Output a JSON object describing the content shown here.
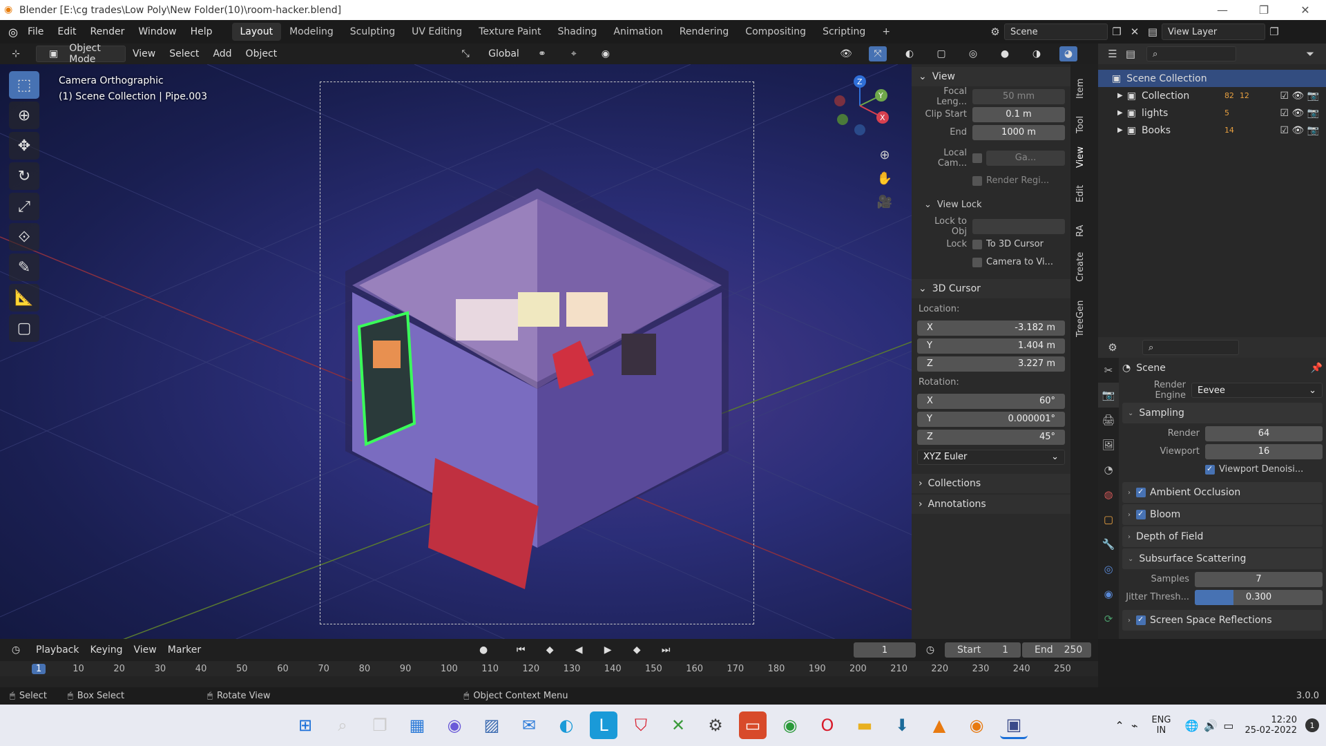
{
  "window": {
    "title": "Blender [E:\\cg trades\\Low Poly\\New Folder(10)\\room-hacker.blend]",
    "minimize": "—",
    "maximize": "❐",
    "close": "✕"
  },
  "menu": [
    "File",
    "Edit",
    "Render",
    "Window",
    "Help"
  ],
  "workspaces": [
    "Layout",
    "Modeling",
    "Sculpting",
    "UV Editing",
    "Texture Paint",
    "Shading",
    "Animation",
    "Rendering",
    "Compositing",
    "Scripting",
    "+"
  ],
  "scene": {
    "label": "Scene",
    "view_layer": "View Layer"
  },
  "header3d": {
    "mode": "Object Mode",
    "menus": [
      "View",
      "Select",
      "Add",
      "Object"
    ],
    "transform": "Global"
  },
  "viewport": {
    "line1": "Camera Orthographic",
    "line2": "(1) Scene Collection | Pipe.003"
  },
  "gizmo": {
    "x": "X",
    "y": "Y",
    "z": "Z"
  },
  "npanel": {
    "view_section": "View",
    "focal_label": "Focal Leng...",
    "focal_value": "50 mm",
    "clip_start_label": "Clip Start",
    "clip_start_value": "0.1 m",
    "clip_end_label": "End",
    "clip_end_value": "1000 m",
    "local_cam_label": "Local Cam...",
    "local_cam_value": "Ga...",
    "render_region": "Render Regi...",
    "view_lock_section": "View Lock",
    "lock_obj_label": "Lock to Obj",
    "lock_label": "Lock",
    "to_3d_cursor": "To 3D Cursor",
    "camera_to_view": "Camera to Vi...",
    "cursor_section": "3D Cursor",
    "location_label": "Location:",
    "loc_x": "-3.182 m",
    "loc_y": "1.404 m",
    "loc_z": "3.227 m",
    "rotation_label": "Rotation:",
    "rot_x": "60°",
    "rot_y": "0.000001°",
    "rot_z": "45°",
    "euler": "XYZ Euler",
    "collections_section": "Collections",
    "annotations_section": "Annotations",
    "axis_x": "X",
    "axis_y": "Y",
    "axis_z": "Z"
  },
  "vtabs": [
    "Item",
    "Tool",
    "View",
    "Edit",
    "RA",
    "Create",
    "TreeGen"
  ],
  "outliner": {
    "root": "Scene Collection",
    "items": [
      {
        "name": "Collection",
        "count1": "82",
        "count2": "12"
      },
      {
        "name": "lights",
        "count1": "5"
      },
      {
        "name": "Books",
        "count1": "14"
      }
    ]
  },
  "properties": {
    "context": "Scene",
    "render_engine_label": "Render Engine",
    "render_engine": "Eevee",
    "sampling": "Sampling",
    "render_label": "Render",
    "render_value": "64",
    "viewport_label": "Viewport",
    "viewport_value": "16",
    "viewport_denoise": "Viewport Denoisi...",
    "ao": "Ambient Occlusion",
    "bloom": "Bloom",
    "dof": "Depth of Field",
    "sss": "Subsurface Scattering",
    "samples_label": "Samples",
    "samples_value": "7",
    "jitter_label": "Jitter Thresh...",
    "jitter_value": "0.300",
    "jitter_fill": 0.3,
    "ssr": "Screen Space Reflections"
  },
  "timeline": {
    "menus": [
      "Playback",
      "Keying",
      "View",
      "Marker"
    ],
    "current_frame": "1",
    "start_label": "Start",
    "start": "1",
    "end_label": "End",
    "end": "250",
    "ticks": [
      "1",
      "10",
      "20",
      "30",
      "40",
      "50",
      "60",
      "70",
      "80",
      "90",
      "100",
      "110",
      "120",
      "130",
      "140",
      "150",
      "160",
      "170",
      "180",
      "190",
      "200",
      "210",
      "220",
      "230",
      "240",
      "250"
    ]
  },
  "status": {
    "select": "Select",
    "box_select": "Box Select",
    "rotate": "Rotate View",
    "context_menu": "Object Context Menu",
    "version": "3.0.0"
  },
  "taskbar": {
    "lang1": "ENG",
    "lang2": "IN",
    "time": "12:20",
    "date": "25-02-2022",
    "notif": "1"
  }
}
